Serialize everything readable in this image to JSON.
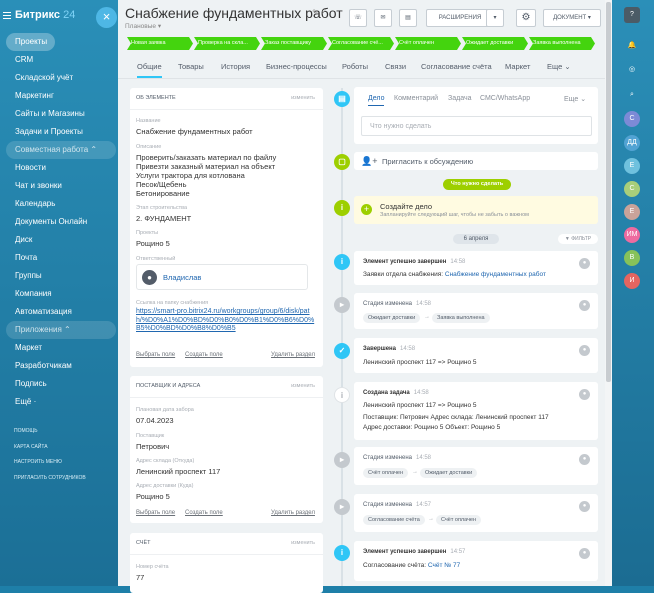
{
  "sidebar": {
    "logo": "Битрикс",
    "logo_num": "24",
    "close": "×",
    "items": [
      "Проекты",
      "CRM",
      "Складской учёт",
      "Маркетинг",
      "Сайты и Магазины",
      "Задачи и Проекты",
      "Совместная работа ⌃",
      "Новости",
      "Чат и звонки",
      "Календарь",
      "Документы Онлайн",
      "Диск",
      "Почта",
      "Группы",
      "Компания",
      "Автоматизация",
      "Приложения ⌃",
      "Маркет",
      "Разработчикам",
      "Подпись",
      "Ещё ·"
    ],
    "small": [
      "ПОМОЩЬ",
      "КАРТА САЙТА",
      "НАСТРОИТЬ МЕНЮ",
      "ПРИГЛАСИТЬ СОТРУДНИКОВ"
    ]
  },
  "header": {
    "title": "Снабжение фундаментных работ",
    "subtitle": "Плановые ▾",
    "ext": "РАСШИРЕНИЯ",
    "doc": "ДОКУМЕНТ",
    "ext_arrow": "▾",
    "doc_arrow": "▾",
    "gear": "⚙",
    "phone": "☏",
    "mail": "✉",
    "chat": "▤",
    "pencil": "✎ ⟋"
  },
  "stages": [
    "Новая заявка",
    "Проверка на скла...",
    "Заказ поставщику",
    "Согласование счё...",
    "Счёт оплачен",
    "Ожидает доставки",
    "Заявка выполнена"
  ],
  "tabs": [
    "Общие",
    "Товары",
    "История",
    "Бизнес-процессы",
    "Роботы",
    "Связи",
    "Согласование счёта",
    "Маркет",
    "Еще ⌄"
  ],
  "about": {
    "head": "ОБ ЭЛЕМЕНТЕ",
    "edit": "изменить",
    "name_l": "Название",
    "name_v": "Снабжение фундаментных работ",
    "desc_l": "Описание",
    "desc_v": [
      "Проверить/заказать материал по файлу",
      "Привезти заказный материал на объект",
      "Услуги трактора для котлована",
      "Песок/Щебень",
      "Бетонирование"
    ],
    "stage_l": "Этап строительства",
    "stage_v": "2. ФУНДАМЕНТ",
    "proj_l": "Проекты",
    "proj_v": "Рощино 5",
    "resp_l": "Ответственный",
    "resp_v": "Владислав",
    "link_l": "Ссылка на папку снабжения",
    "link_v": "https://smart-pro.bitrix24.ru/workgroups/group/6/disk/path/%D0%A1%D0%BD%D0%B0%D0%B1%D0%B6%D0%B5%D0%BD%D0%B8%D0%B5",
    "a1": "Выбрать поле",
    "a2": "Создать поле",
    "a3": "Удалить раздел"
  },
  "supplier": {
    "head": "ПОСТАВЩИК И АДРЕСА",
    "edit": "изменить",
    "date_l": "Плановая дата забора",
    "date_v": "07.04.2023",
    "sup_l": "Поставщик",
    "sup_v": "Петрович",
    "from_l": "Адрес склада (Откуда)",
    "from_v": "Ленинский проспект 117",
    "to_l": "Адрес доставки (Куда)",
    "to_v": "Рощино 5",
    "a1": "Выбрать поле",
    "a2": "Создать поле",
    "a3": "Удалить раздел"
  },
  "invoice": {
    "head": "СЧЁТ",
    "edit": "изменить",
    "num_l": "Номер счёта",
    "num_v": "77"
  },
  "composer": {
    "tabs": [
      "Дело",
      "Комментарий",
      "Задача",
      "СМС/WhatsApp",
      "Еще ⌄"
    ],
    "placeholder": "Что нужно сделать"
  },
  "invite": "Пригласить к обсуждению",
  "todo_pill": "Что нужно сделать",
  "create": {
    "title": "Создайте дело",
    "sub": "Запланируйте следующий шаг, чтобы не забыть о важном"
  },
  "date_pill": "6 апреля",
  "filter": "ФИЛЬТР",
  "events": [
    {
      "title": "Элемент успешно завершен",
      "time": "14:58",
      "body": "Заявки отдела снабжения:",
      "link": "Снабжение фундаментных работ"
    },
    {
      "title": "Стадия изменена",
      "time": "14:58",
      "from": "Ожидает доставки",
      "to": "Заявка выполнена"
    },
    {
      "title": "Завершена",
      "time": "14:58",
      "body": "",
      "link": "Ленинский проспект 117 => Рощино 5"
    },
    {
      "title": "Создана задача",
      "time": "14:58",
      "link": "Ленинский проспект 117 => Рощино 5",
      "l2": "Поставщик: Петрович Адрес склада: Ленинский проспект 117",
      "l3": "Адрес доставки: Рощино 5 Объект: Рощино 5"
    },
    {
      "title": "Стадия изменена",
      "time": "14:58",
      "from": "Счёт оплачен",
      "to": "Ожидает доставки"
    },
    {
      "title": "Стадия изменена",
      "time": "14:57",
      "from": "Согласование счёта",
      "to": "Счёт оплачен"
    },
    {
      "title": "Элемент успешно завершен",
      "time": "14:57",
      "body": "Согласование счёта:",
      "link": "Счёт № 77"
    }
  ],
  "right_icons": [
    {
      "label": "?",
      "color": "#4b5b66"
    },
    {
      "label": "🔔",
      "color": "transparent"
    },
    {
      "label": "◎",
      "color": "transparent"
    },
    {
      "label": "⌕",
      "color": "transparent"
    },
    {
      "label": "С",
      "color": "#7c8ad6"
    },
    {
      "label": "ДД",
      "color": "#52a3d3"
    },
    {
      "label": "Е",
      "color": "#6fc1de"
    },
    {
      "label": "С",
      "color": "#a8ce7a"
    },
    {
      "label": "Е",
      "color": "#c9a39a"
    },
    {
      "label": "ИМ",
      "color": "#ee6ba0"
    },
    {
      "label": "В",
      "color": "#87c25a"
    },
    {
      "label": "И",
      "color": "#e46560"
    }
  ]
}
